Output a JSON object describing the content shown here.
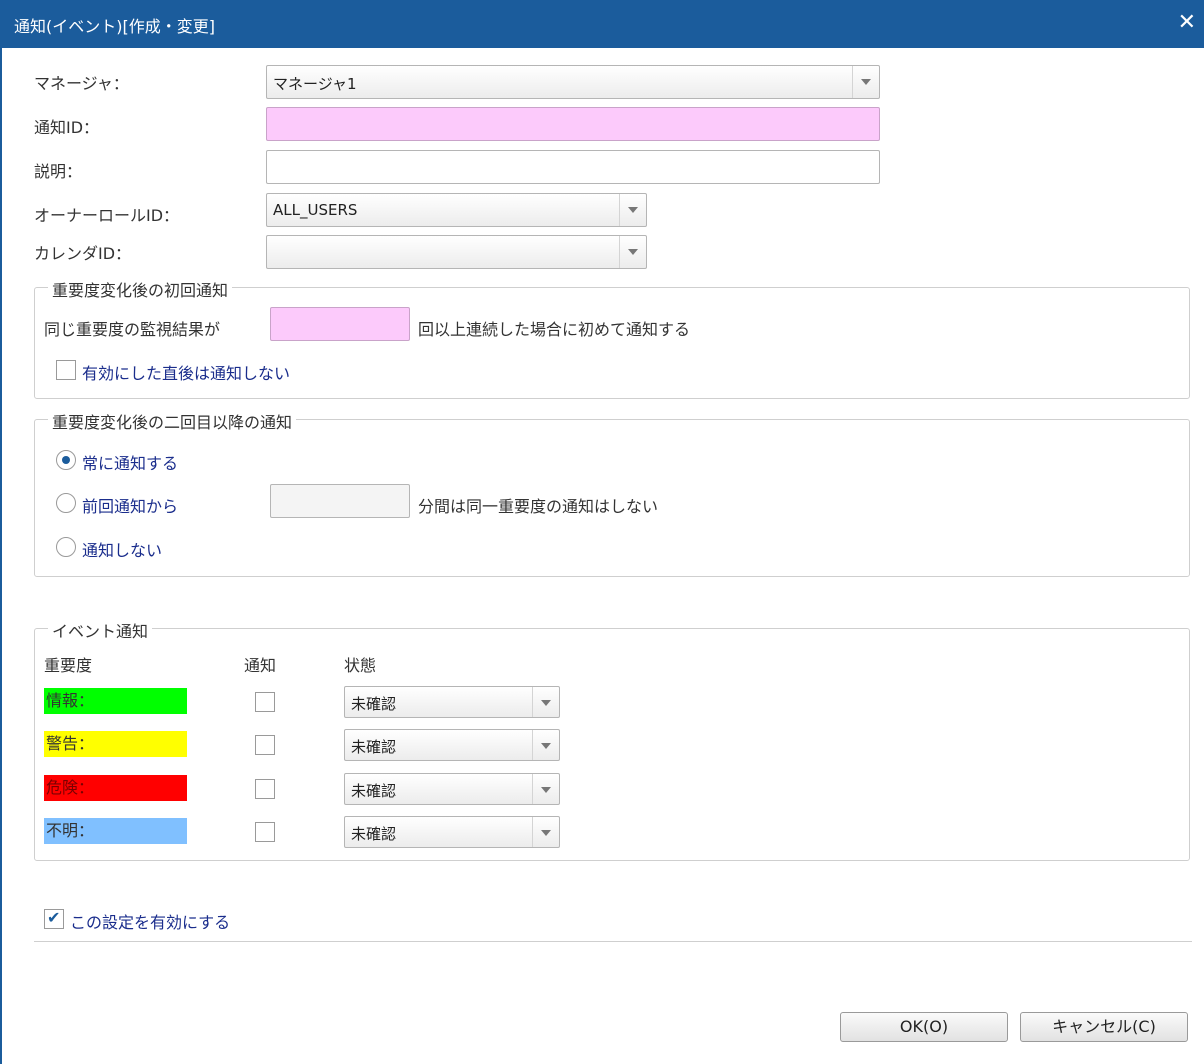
{
  "window": {
    "title": "通知(イベント)[作成・変更]"
  },
  "form": {
    "manager": {
      "label": "マネージャ：",
      "value": "マネージャ1"
    },
    "notify_id": {
      "label": "通知ID：",
      "value": ""
    },
    "description": {
      "label": "説明：",
      "value": ""
    },
    "owner_role": {
      "label": "オーナーロールID：",
      "value": "ALL_USERS"
    },
    "calendar": {
      "label": "カレンダID：",
      "value": ""
    }
  },
  "first_notice": {
    "legend": "重要度変化後の初回通知",
    "prefix": "同じ重要度の監視結果が",
    "count": "",
    "suffix": "回以上連続した場合に初めて通知する",
    "no_notify_after_enable": {
      "label": "有効にした直後は通知しない",
      "checked": false
    }
  },
  "subsequent_notice": {
    "legend": "重要度変化後の二回目以降の通知",
    "always": {
      "label": "常に通知する",
      "selected": true
    },
    "from_previous": {
      "label": "前回通知から",
      "selected": false,
      "minutes": "",
      "suffix": "分間は同一重要度の通知はしない"
    },
    "never": {
      "label": "通知しない",
      "selected": false
    }
  },
  "event_notice": {
    "legend": "イベント通知",
    "headers": {
      "severity": "重要度",
      "notify": "通知",
      "state": "状態"
    },
    "rows": [
      {
        "label": "情報：",
        "color": "#00ff00",
        "text_color": "#333333",
        "notify": false,
        "state": "未確認"
      },
      {
        "label": "警告：",
        "color": "#ffff00",
        "text_color": "#333333",
        "notify": false,
        "state": "未確認"
      },
      {
        "label": "危険：",
        "color": "#ff0000",
        "text_color": "#7a0000",
        "notify": false,
        "state": "未確認"
      },
      {
        "label": "不明：",
        "color": "#80c0ff",
        "text_color": "#333333",
        "notify": false,
        "state": "未確認"
      }
    ]
  },
  "enable": {
    "label": "この設定を有効にする",
    "checked": true
  },
  "buttons": {
    "ok": "OK(O)",
    "cancel": "キャンセル(C)"
  }
}
